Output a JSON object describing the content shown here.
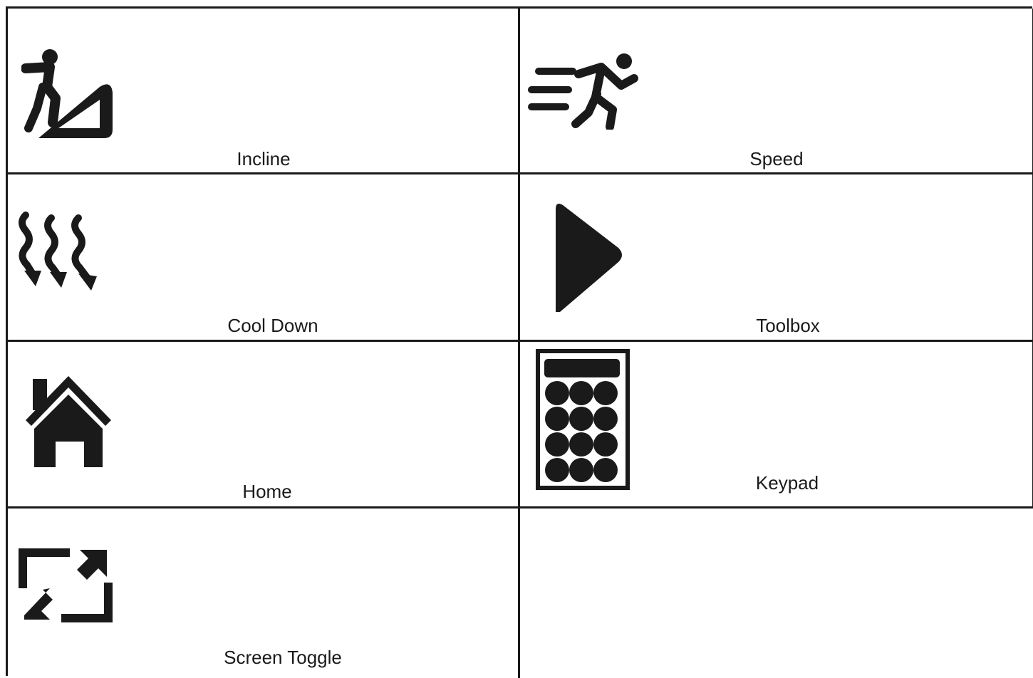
{
  "items": [
    {
      "label": "Incline",
      "icon": "incline-icon"
    },
    {
      "label": "Speed",
      "icon": "speed-icon"
    },
    {
      "label": "Cool Down",
      "icon": "cool-down-icon"
    },
    {
      "label": "Toolbox",
      "icon": "play-icon"
    },
    {
      "label": "Home",
      "icon": "home-icon"
    },
    {
      "label": "Keypad",
      "icon": "keypad-icon"
    },
    {
      "label": "Screen Toggle",
      "icon": "screen-toggle-icon"
    }
  ],
  "colors": {
    "ink": "#1a1a1a",
    "background": "#ffffff"
  }
}
